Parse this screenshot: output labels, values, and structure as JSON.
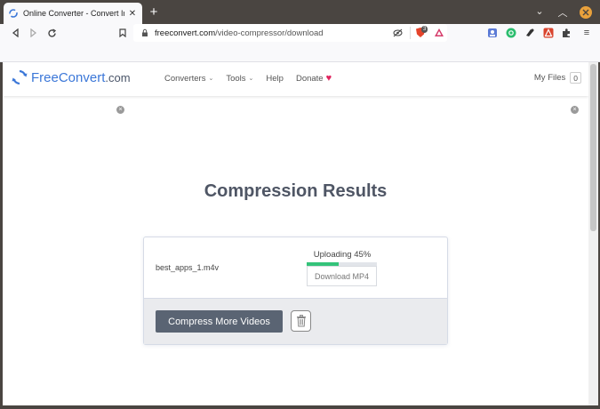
{
  "browser": {
    "tab_title": "Online Converter - Convert Ima",
    "new_tab_label": "+",
    "url_domain": "freeconvert.com",
    "url_path": "/video-compressor/download",
    "brave_badge": "3"
  },
  "header": {
    "logo_brand": "FreeConvert",
    "logo_tld": ".com",
    "menu": {
      "converters": "Converters",
      "tools": "Tools",
      "help": "Help",
      "donate": "Donate"
    },
    "my_files_label": "My Files",
    "my_files_count": "0"
  },
  "main": {
    "heading": "Compression Results",
    "file": {
      "name": "best_apps_1.m4v",
      "status": "Uploading 45%",
      "progress": 0.45,
      "download_label": "Download MP4"
    },
    "compress_more_label": "Compress More Videos"
  },
  "colors": {
    "brand": "#3b77d8",
    "progress": "#34c37a",
    "button": "#5a6473",
    "heart": "#e0245e"
  }
}
